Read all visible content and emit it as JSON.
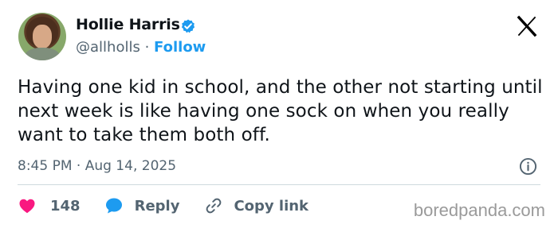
{
  "author": {
    "name": "Hollie Harris",
    "handle": "@allholls",
    "separator": "·",
    "follow_label": "Follow",
    "verified": true
  },
  "tweet": {
    "text": "Having one kid in school, and the other not starting until next week is like having one sock on when you really want to take them both off.",
    "timestamp": "8:45 PM · Aug 14, 2025"
  },
  "actions": {
    "like_count": "148",
    "reply_label": "Reply",
    "copy_link_label": "Copy link"
  },
  "watermark": "boredpanda.com",
  "icons": {
    "verified": "verified-badge-icon",
    "x_logo": "x-logo-icon",
    "info": "info-icon",
    "like": "heart-icon",
    "reply": "speech-bubble-icon",
    "copy": "link-icon"
  },
  "colors": {
    "accent": "#1d9bf0",
    "like": "#f91880",
    "text": "#0f1419",
    "muted": "#536471"
  }
}
